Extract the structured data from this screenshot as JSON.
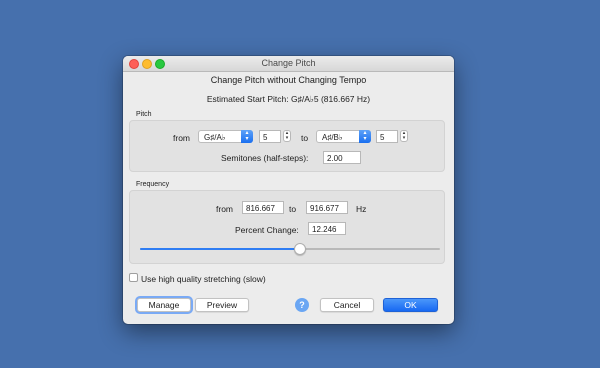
{
  "window": {
    "title": "Change Pitch"
  },
  "header": {
    "heading": "Change Pitch without Changing Tempo",
    "start_pitch": "Estimated Start Pitch: G♯/A♭5 (816.667 Hz)"
  },
  "pitch": {
    "section_label": "Pitch",
    "from_label": "from",
    "from_note": "G♯/A♭",
    "from_octave": "5",
    "to_label": "to",
    "to_note": "A♯/B♭",
    "to_octave": "5",
    "semitones_label": "Semitones (half-steps):",
    "semitones_value": "2.00"
  },
  "frequency": {
    "section_label": "Frequency",
    "from_label": "from",
    "from_value": "816.667",
    "to_label": "to",
    "to_value": "916.677",
    "unit": "Hz",
    "percent_label": "Percent Change:",
    "percent_value": "12.246",
    "slider_fraction": 0.53
  },
  "options": {
    "high_quality_label": "Use high quality stretching (slow)",
    "high_quality_checked": false
  },
  "buttons": {
    "manage": "Manage",
    "preview": "Preview",
    "help": "?",
    "cancel": "Cancel",
    "ok": "OK"
  },
  "colors": {
    "desktop": "#4670ad",
    "accent": "#1a6ff0"
  }
}
